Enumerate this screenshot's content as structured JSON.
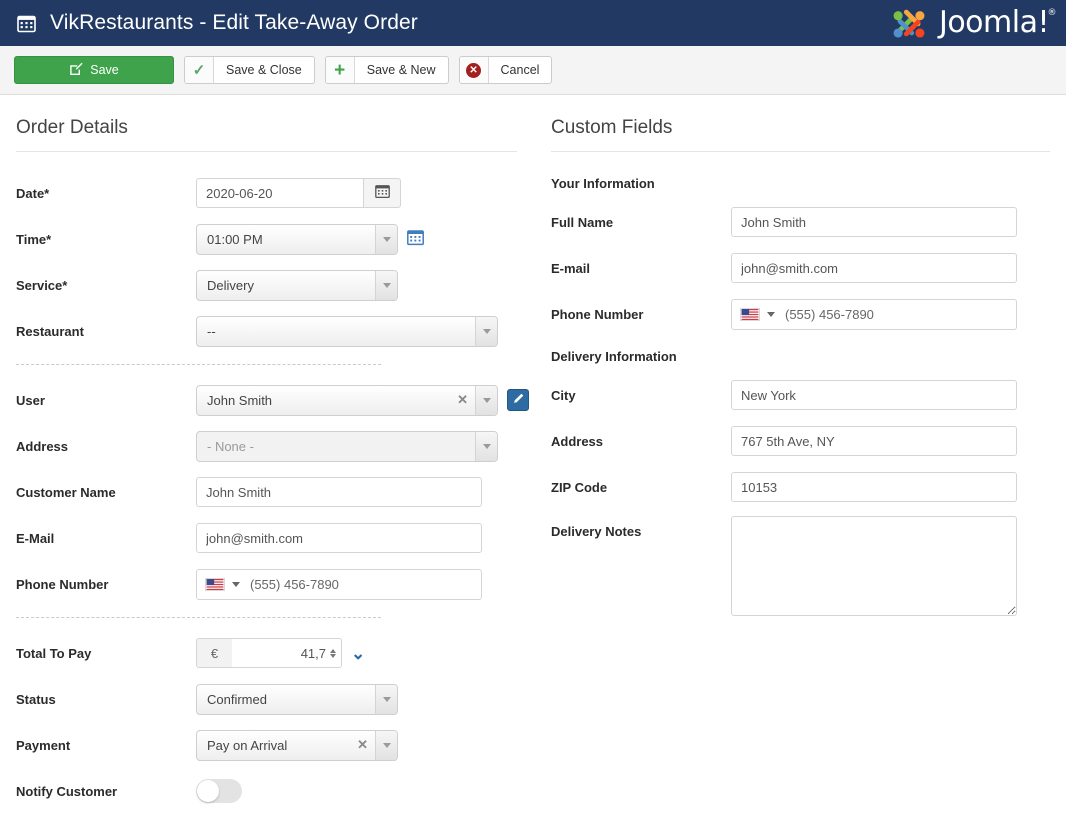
{
  "header": {
    "icon": "calendar-icon",
    "title": "VikRestaurants - Edit Take-Away Order",
    "brand": "Joomla!",
    "brand_sup": "®",
    "bg_color": "#223a63"
  },
  "toolbar": {
    "save_label": "Save",
    "save_icon": "edit-square-icon",
    "save_color": "#3ea34b",
    "save_close_label": "Save & Close",
    "save_close_icon": "check-icon",
    "save_new_label": "Save & New",
    "save_new_icon": "plus-icon",
    "cancel_label": "Cancel",
    "cancel_icon": "circle-x-icon",
    "cancel_icon_color": "#a32020"
  },
  "order_details": {
    "title": "Order Details",
    "date": {
      "label": "Date*",
      "value": "2020-06-20",
      "button_icon": "calendar-icon"
    },
    "time": {
      "label": "Time*",
      "value": "01:00 PM",
      "button_icon": "calendar-clock-icon"
    },
    "service": {
      "label": "Service*",
      "value": "Delivery"
    },
    "restaurant": {
      "label": "Restaurant",
      "value": "--"
    },
    "user": {
      "label": "User",
      "value": "John Smith",
      "clear_icon": "clear-x-icon",
      "edit_icon": "pencil-icon"
    },
    "address": {
      "label": "Address",
      "value": "- None -",
      "disabled": true
    },
    "customer_name": {
      "label": "Customer Name",
      "value": "John Smith"
    },
    "email": {
      "label": "E-Mail",
      "value": "john@smith.com"
    },
    "phone": {
      "label": "Phone Number",
      "country_flag": "us-flag-icon",
      "value": "(555) 456-7890"
    },
    "total_to_pay": {
      "label": "Total To Pay",
      "currency": "€",
      "value": "41,7",
      "expand_icon": "chevron-down-icon"
    },
    "status": {
      "label": "Status",
      "value": "Confirmed"
    },
    "payment": {
      "label": "Payment",
      "value": "Pay on Arrival",
      "clear_icon": "clear-x-icon"
    },
    "notify_customer": {
      "label": "Notify Customer",
      "checked": false
    }
  },
  "custom_fields": {
    "title": "Custom Fields",
    "group_your_information": "Your Information",
    "full_name": {
      "label": "Full Name",
      "value": "John Smith"
    },
    "email": {
      "label": "E-mail",
      "value": "john@smith.com"
    },
    "phone": {
      "label": "Phone Number",
      "country_flag": "us-flag-icon",
      "value": "(555) 456-7890"
    },
    "group_delivery_information": "Delivery Information",
    "city": {
      "label": "City",
      "value": "New York"
    },
    "address": {
      "label": "Address",
      "value": "767 5th Ave, NY"
    },
    "zip": {
      "label": "ZIP Code",
      "value": "10153"
    },
    "notes": {
      "label": "Delivery Notes",
      "value": ""
    }
  }
}
